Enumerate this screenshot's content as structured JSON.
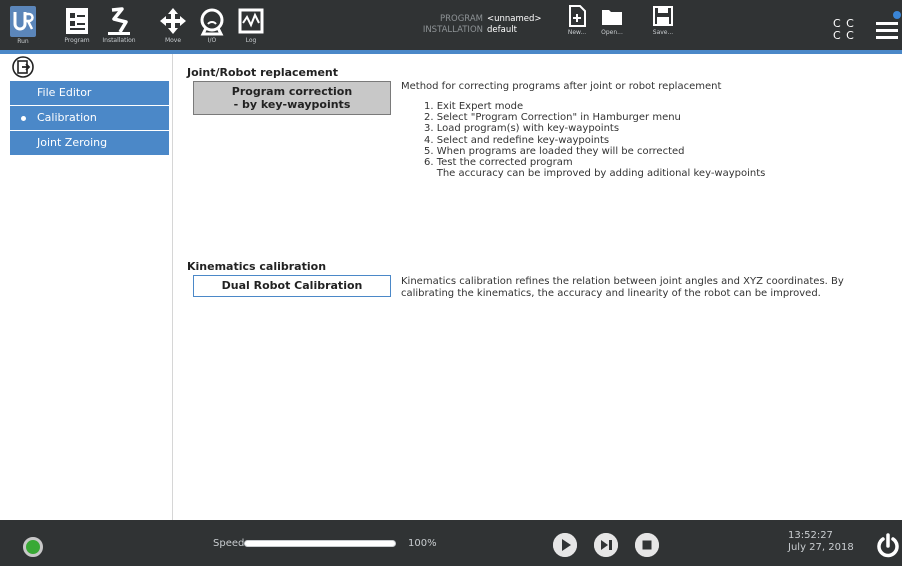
{
  "topbar": {
    "nav": [
      {
        "label": "Run",
        "icon": "ur-logo-icon"
      },
      {
        "label": "Program",
        "icon": "program-icon"
      },
      {
        "label": "Installation",
        "icon": "installation-icon"
      },
      {
        "label": "Move",
        "icon": "move-icon"
      },
      {
        "label": "I/O",
        "icon": "io-icon"
      },
      {
        "label": "Log",
        "icon": "log-icon"
      }
    ],
    "program_key": "PROGRAM",
    "program_value": "<unnamed>",
    "installation_key": "INSTALLATION",
    "installation_value": "default",
    "file_actions": [
      {
        "label": "New...",
        "icon": "new-file-icon"
      },
      {
        "label": "Open...",
        "icon": "open-folder-icon"
      },
      {
        "label": "Save...",
        "icon": "save-icon"
      }
    ],
    "cc_line1": "C C",
    "cc_line2": "C C",
    "menu_icon": "hamburger-menu-icon"
  },
  "sidebar": {
    "exit_icon": "exit-icon",
    "items": [
      {
        "label": "File Editor"
      },
      {
        "label": "Calibration"
      },
      {
        "label": "Joint Zeroing"
      }
    ]
  },
  "main": {
    "joint_section": {
      "title": "Joint/Robot replacement",
      "button_line1": "Program correction",
      "button_line2": "- by key-waypoints",
      "description": "Method for correcting programs after joint or robot replacement",
      "steps": [
        "1. Exit Expert mode",
        "2. Select \"Program Correction\" in Hamburger menu",
        "3. Load program(s) with key-waypoints",
        "4. Select and redefine key-waypoints",
        "5. When programs are loaded they will be corrected",
        "6. Test the corrected program",
        "    The accuracy can be improved by adding aditional key-waypoints"
      ]
    },
    "kinematics_section": {
      "title": "Kinematics calibration",
      "button": "Dual Robot Calibration",
      "description_line1": "Kinematics calibration refines the relation between joint angles and XYZ coordinates. By",
      "description_line2": "calibrating the kinematics, the accuracy and linearity of the robot can be improved."
    }
  },
  "bottombar": {
    "speed_label": "Speed",
    "speed_value": "100%",
    "speed_fraction": 1.0,
    "time": "13:52:27",
    "date": "July 27, 2018",
    "colors": {
      "status": "#39a935",
      "accent": "#4b88c8"
    }
  }
}
